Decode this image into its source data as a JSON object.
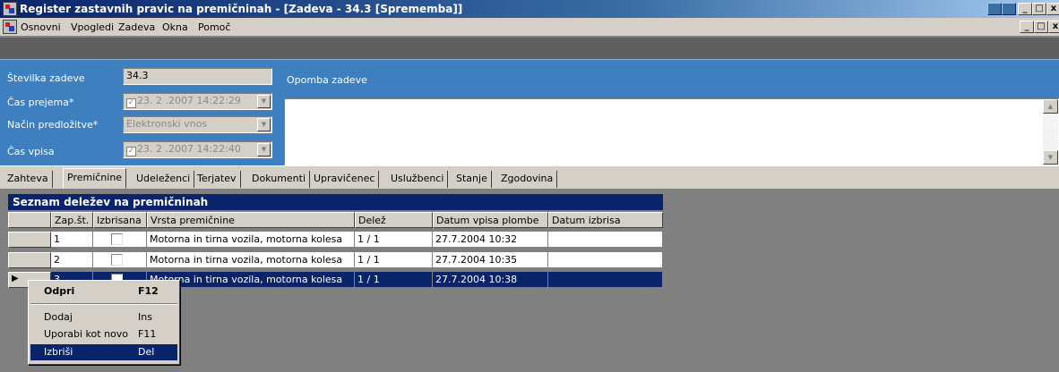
{
  "window": {
    "title": "Register zastavnih pravic na premičninah - [Zadeva - 34.3 [Sprememba]]"
  },
  "menu": [
    "Osnovni",
    "Vpogledi",
    "Zadeva",
    "Okna",
    "Pomoč"
  ],
  "header": {
    "case_number_label": "Številka zadeve",
    "case_number_value": "34.3",
    "received_label": "Čas prejema*",
    "received_value": "23. 2 .2007 14:22:29",
    "submission_label": "Način predložitve*",
    "submission_value": "Elektronski vnos",
    "entry_label": "Čas vpisa",
    "entry_value": "23. 2 .2007 14:22:40",
    "note_label": "Opomba zadeve"
  },
  "tabs": [
    "Zahteva",
    "Premičnine",
    "Udeleženci",
    "Terjatev",
    "Dokumenti",
    "Upravičenec",
    "Uslužbenci",
    "Stanje",
    "Zgodovina"
  ],
  "active_tab": "Premičnine",
  "grid": {
    "title": "Seznam deležev na premičninah",
    "columns": [
      "Zap.št.",
      "Izbrisana",
      "Vrsta premičnine",
      "Delež",
      "Datum vpisa plombe",
      "Datum izbrisa"
    ],
    "rows": [
      {
        "no": "1",
        "type": "Motorna in tirna vozila, motorna kolesa",
        "share": "1 / 1",
        "date": "27.7.2004 10:32",
        "deleted": ""
      },
      {
        "no": "2",
        "type": "Motorna in tirna vozila, motorna kolesa",
        "share": "1 / 1",
        "date": "27.7.2004 10:35",
        "deleted": ""
      },
      {
        "no": "3",
        "type": "Motorna in tirna vozila, motorna kolesa",
        "share": "1 / 1",
        "date": "27.7.2004 10:38",
        "deleted": ""
      }
    ],
    "selected_row": 3
  },
  "context_menu": [
    {
      "label": "Odpri",
      "key": "F12"
    },
    {
      "label": "Dodaj",
      "key": "Ins"
    },
    {
      "label": "Uporabi kot novo",
      "key": "F11"
    },
    {
      "label": "Izbriši",
      "key": "Del"
    }
  ],
  "colors": {
    "title_bar": "#0a246a",
    "header_bg": "#3d7fbf",
    "selection": "#0a246a",
    "window_bg": "#808080"
  }
}
